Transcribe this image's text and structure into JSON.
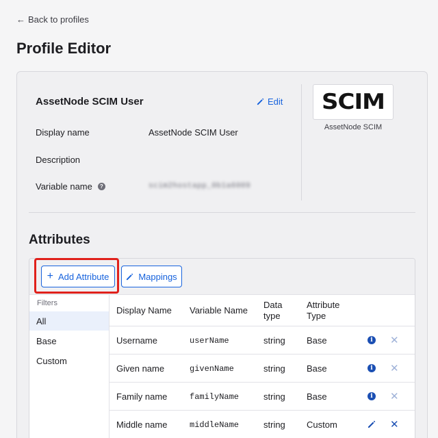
{
  "nav": {
    "back_label": "Back to profiles",
    "back_arrow": "←"
  },
  "page": {
    "title": "Profile Editor"
  },
  "profile": {
    "name": "AssetNode SCIM User",
    "edit_label": "Edit",
    "fields": {
      "display_name_label": "Display name",
      "display_name_value": "AssetNode SCIM User",
      "description_label": "Description",
      "description_value": "",
      "variable_name_label": "Variable name",
      "variable_name_value": "scim2hostapp_0b1a6009"
    },
    "logo": {
      "text": "SCIM",
      "caption": "AssetNode SCIM"
    }
  },
  "attributes": {
    "title": "Attributes",
    "add_button": "Add Attribute",
    "mappings_button": "Mappings",
    "filters": {
      "title": "Filters",
      "items": [
        "All",
        "Base",
        "Custom"
      ],
      "active": "All"
    },
    "columns": {
      "display_name": "Display Name",
      "variable_name": "Variable Name",
      "data_type_1": "Data",
      "data_type_2": "type",
      "attribute_type_1": "Attribute",
      "attribute_type_2": "Type"
    },
    "rows": [
      {
        "display_name": "Username",
        "variable_name": "userName",
        "data_type": "string",
        "attribute_type": "Base",
        "action_icon": "info-icon",
        "remove_icon": "close-icon"
      },
      {
        "display_name": "Given name",
        "variable_name": "givenName",
        "data_type": "string",
        "attribute_type": "Base",
        "action_icon": "info-icon",
        "remove_icon": "close-icon"
      },
      {
        "display_name": "Family name",
        "variable_name": "familyName",
        "data_type": "string",
        "attribute_type": "Base",
        "action_icon": "info-icon",
        "remove_icon": "close-icon"
      },
      {
        "display_name": "Middle name",
        "variable_name": "middleName",
        "data_type": "string",
        "attribute_type": "Custom",
        "action_icon": "pencil-icon",
        "remove_icon": "close-icon"
      }
    ]
  },
  "colors": {
    "accent": "#1662dd",
    "highlight": "#e0201b",
    "icon_blue": "#1b4fb3"
  }
}
